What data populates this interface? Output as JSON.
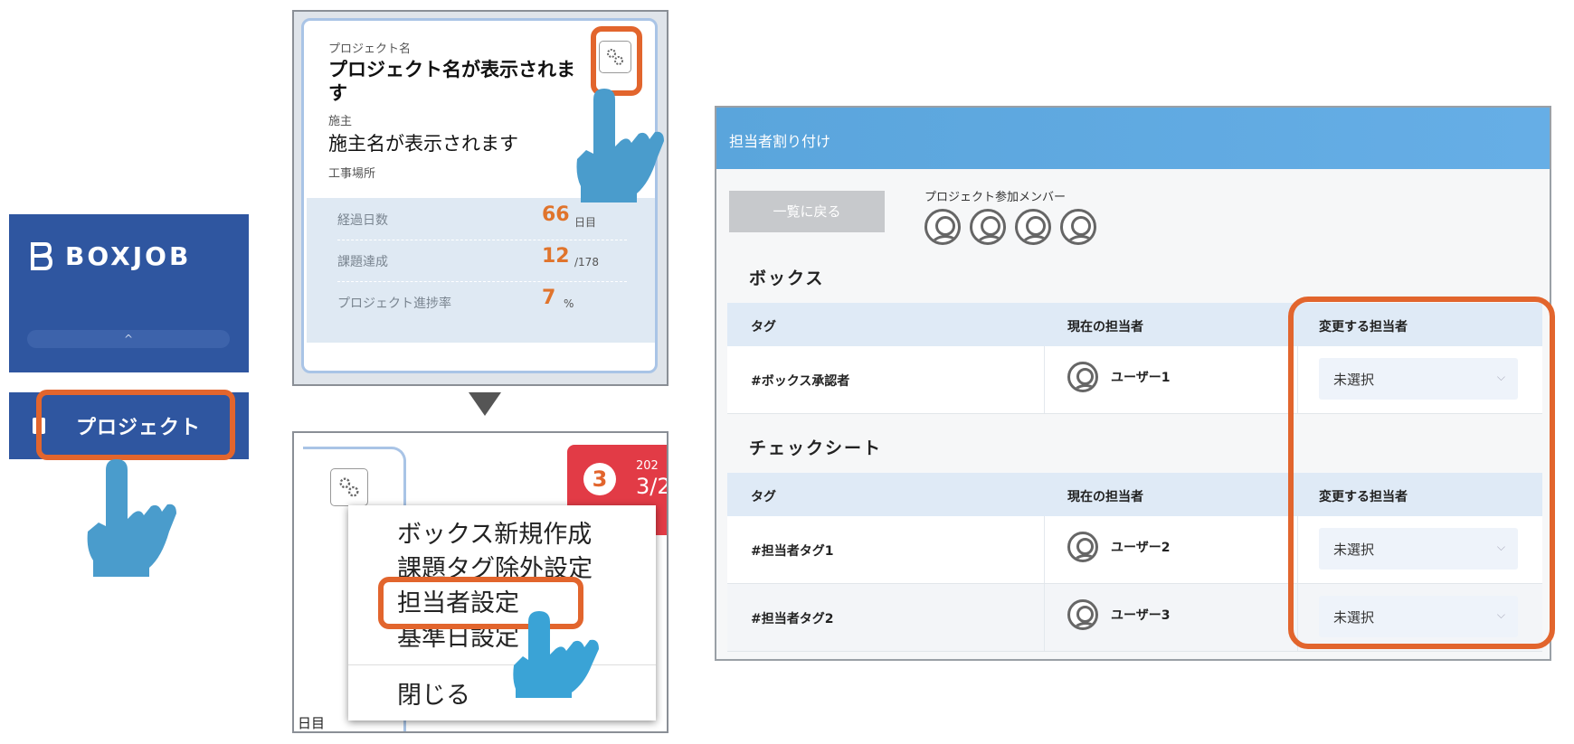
{
  "sidebar": {
    "logo_text": "BOXJOB",
    "collapse_glyph": "^",
    "project_item": "プロジェクト"
  },
  "project_card": {
    "name_label": "プロジェクト名",
    "name_value_line1": "プロジェクト名が表示されま",
    "name_value_line2": "す",
    "owner_label": "施主",
    "owner_value": "施主名が表示されます",
    "location_label": "工事場所",
    "stats": [
      {
        "label": "経過日数",
        "value": "66",
        "unit": "日目"
      },
      {
        "label": "課題達成",
        "value": "12",
        "unit": "/178"
      },
      {
        "label": "プロジェクト進捗率",
        "value": "7",
        "unit": "%"
      }
    ]
  },
  "gear_menu": {
    "badge": "3",
    "red_card_text_top": "202",
    "red_card_text_bottom": "3/2",
    "items": [
      "ボックス新規作成",
      "課題タグ除外設定",
      "担当者設定",
      "基準日設定",
      "閉じる"
    ],
    "footer_text": "日目"
  },
  "assignment": {
    "header_title": "担当者割り付け",
    "back_button": "一覧に戻る",
    "members_label": "プロジェクト参加メンバー",
    "sections": [
      {
        "title": "ボックス",
        "columns": [
          "タグ",
          "現在の担当者",
          "変更する担当者"
        ],
        "rows": [
          {
            "tag": "#ボックス承認者",
            "current": "ユーザー1",
            "change": "未選択"
          }
        ]
      },
      {
        "title": "チェックシート",
        "columns": [
          "タグ",
          "現在の担当者",
          "変更する担当者"
        ],
        "rows": [
          {
            "tag": "#担当者タグ1",
            "current": "ユーザー2",
            "change": "未選択"
          },
          {
            "tag": "#担当者タグ2",
            "current": "ユーザー3",
            "change": "未選択"
          }
        ]
      }
    ]
  },
  "colors": {
    "brand_blue": "#2f56a0",
    "highlight_orange": "#e2652d",
    "header_blue": "#5aa5dc",
    "hand_blue": "#4a9ccc"
  }
}
